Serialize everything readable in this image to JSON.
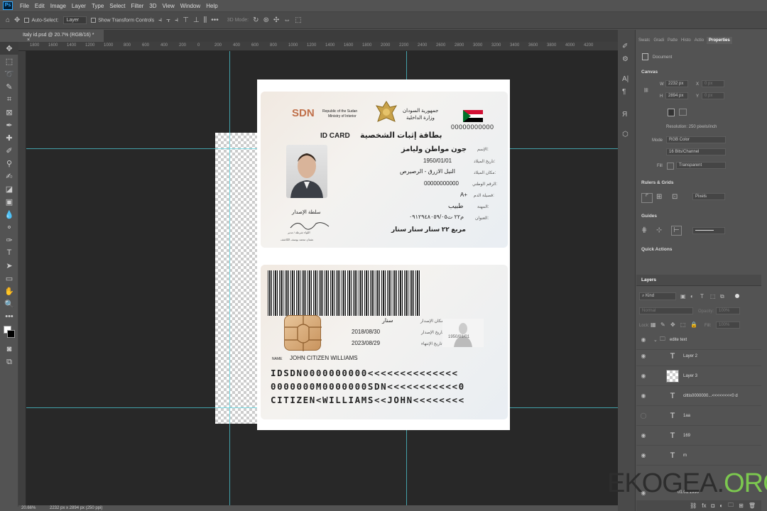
{
  "app": {
    "logo": "Ps"
  },
  "menu": [
    "File",
    "Edit",
    "Image",
    "Layer",
    "Type",
    "Select",
    "Filter",
    "3D",
    "View",
    "Window",
    "Help"
  ],
  "options": {
    "auto_select_label": "Auto-Select:",
    "auto_select_value": "Layer",
    "transform_label": "Show Transform Controls",
    "mode3d": "3D Mode:"
  },
  "document_tab": "Italy id.psd @ 20.7% (RGB/16) *",
  "ruler_ticks": [
    "1800",
    "1600",
    "1400",
    "1200",
    "1000",
    "800",
    "600",
    "400",
    "200",
    "0",
    "200",
    "400",
    "600",
    "800",
    "1000",
    "1200",
    "1400",
    "1600",
    "1800",
    "2000",
    "2200",
    "2400",
    "2600",
    "2800",
    "3000",
    "3200",
    "3400",
    "3600",
    "3800",
    "4000",
    "4200"
  ],
  "card_front": {
    "sdn": "SDN",
    "republic": "Republic of the Sudan",
    "ministry": "Ministry of Interior",
    "ar_republic": "جمهورية السودان",
    "ar_ministry": "وزارة الداخلية",
    "id_number": "00000000000",
    "id_card": "ID CARD",
    "ar_id_card": "بطاقة إثبات الشخصية",
    "rows": [
      {
        "label": "الإسم:",
        "value": "جون مواطن وليامز"
      },
      {
        "label": "تاريخ الميلاد:",
        "value": "1950/01/01"
      },
      {
        "label": "مكان الميلاد:",
        "value": "النيل الازرق - الرصيرص"
      },
      {
        "label": "الرقم الوطني:",
        "value": "00000000000"
      },
      {
        "label": "فصيلة الدم:",
        "value": "A+"
      },
      {
        "label": "المهنة:",
        "value": "طبيب"
      },
      {
        "label": "العنوان:",
        "value": "م٢٢ ت٠٩١٢٩٤٨٠٥٩/٠٥"
      },
      {
        "label": "",
        "value": "مربع ٢٢ سنار سنار سنار"
      }
    ],
    "issuer": "سلطة الإصدار",
    "sig_line": "اللواء شرطة / مدير",
    "sig_sub": "عثمان محمد يوسف الكاشف"
  },
  "card_back": {
    "rows": [
      {
        "label": "مكان الإصدار:",
        "value": "سنار"
      },
      {
        "label": "تاريخ الإصدار:",
        "value": "2018/08/30"
      },
      {
        "label": "تاريخ الإنتهاء:",
        "value": "2023/08/29"
      }
    ],
    "name_label": "NAME",
    "name": "JOHN CITIZEN WILLIAMS",
    "ghost_date": "1950/01/01",
    "mrz": [
      "IDSDN0000000000<<<<<<<<<<<<<<",
      "0000000M0000000SDN<<<<<<<<<<<0",
      "CITIZEN<WILLIAMS<<JOHN<<<<<<<<"
    ]
  },
  "status": {
    "zoom": "20.66%",
    "dims": "2232 px x 2894 px (250 ppi)"
  },
  "panel": {
    "tabs": [
      "Swatc",
      "Gradi",
      "Patte",
      "Histo",
      "Actio",
      "Properties"
    ],
    "doc_label": "Document",
    "canvas_title": "Canvas",
    "w_label": "W",
    "w_value": "2232 px",
    "h_label": "H",
    "h_value": "2894 px",
    "x_label": "X",
    "x_value": "0 px",
    "y_label": "Y",
    "y_value": "0 px",
    "resolution": "Resolution: 250 pixels/inch",
    "mode_label": "Mode",
    "mode_value": "RGB Color",
    "depth_value": "16 Bits/Channel",
    "fill_label": "Fill",
    "fill_value": "Transparent",
    "rulers_title": "Rulers & Grids",
    "units_value": "Pixels",
    "guides_title": "Guides",
    "quick_title": "Quick Actions"
  },
  "layers": {
    "title": "Layers",
    "kind": "Kind",
    "blend": "Normal",
    "opacity_label": "Opacity:",
    "opacity_value": "100%",
    "lock_label": "Lock:",
    "fill_label": "Fill:",
    "fill_value": "100%",
    "items": [
      {
        "name": "edite text",
        "kind": "folder"
      },
      {
        "name": "Layer 2",
        "kind": "text"
      },
      {
        "name": "Layer 3",
        "kind": "image"
      },
      {
        "name": "cittis0000000...<<<<<<<<0 d",
        "kind": "text"
      },
      {
        "name": "1aa",
        "kind": "text"
      },
      {
        "name": "169",
        "kind": "text"
      },
      {
        "name": "m",
        "kind": "text"
      },
      {
        "name": "01.01.1990",
        "kind": "text"
      }
    ]
  },
  "watermark": {
    "main": "EKOGEA",
    "dot": ".",
    "org": "ORG"
  }
}
